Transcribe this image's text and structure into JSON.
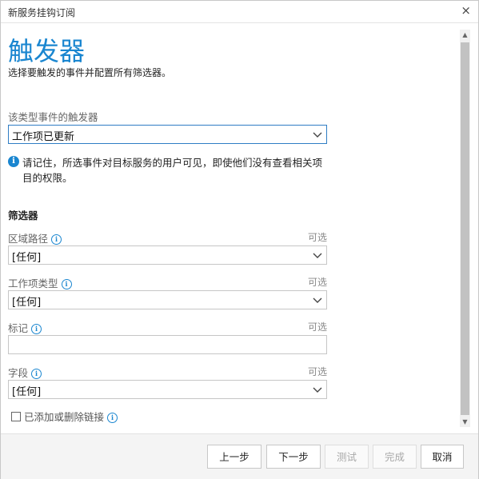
{
  "window": {
    "title": "新服务挂钩订阅",
    "close_glyph": "×"
  },
  "page": {
    "heading": "触发器",
    "subtitle": "选择要触发的事件并配置所有筛选器。"
  },
  "trigger": {
    "label": "该类型事件的触发器",
    "value": "工作项已更新"
  },
  "notice": "请记住，所选事件对目标服务的用户可见，即使他们没有查看相关项目的权限。",
  "filters": {
    "section_title": "筛选器",
    "optional_text": "可选",
    "area_path": {
      "label": "区域路径",
      "value": "[任何]"
    },
    "work_item_type": {
      "label": "工作项类型",
      "value": "[任何]"
    },
    "tag": {
      "label": "标记",
      "value": ""
    },
    "field": {
      "label": "字段",
      "value": "[任何]"
    },
    "links_checkbox": {
      "label": "已添加或删除链接",
      "checked": false
    }
  },
  "buttons": {
    "previous": "上一步",
    "next": "下一步",
    "test": "测试",
    "finish": "完成",
    "cancel": "取消"
  },
  "colors": {
    "accent": "#1a86d0"
  },
  "icons": [
    "close-icon",
    "info-icon",
    "chevron-down-icon",
    "scroll-up-icon",
    "scroll-down-icon"
  ]
}
